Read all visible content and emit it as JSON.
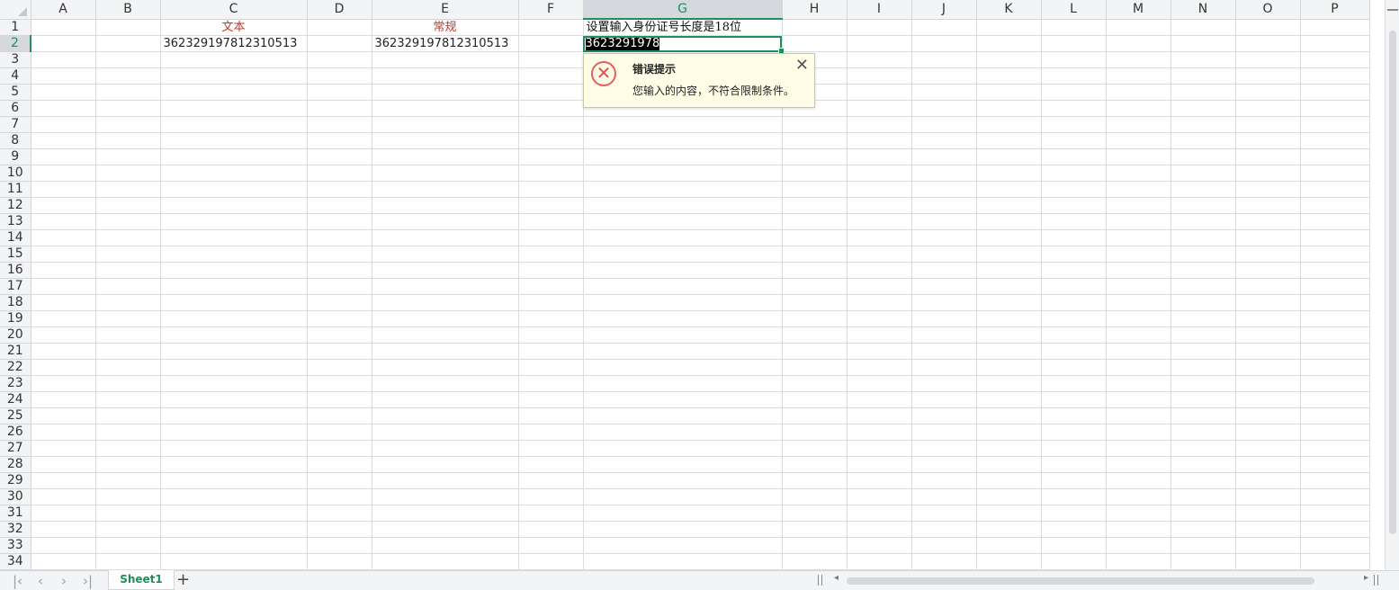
{
  "columns": [
    "A",
    "B",
    "C",
    "D",
    "E",
    "F",
    "G",
    "H",
    "I",
    "J",
    "K",
    "L",
    "M",
    "N",
    "O",
    "P"
  ],
  "rows": [
    "1",
    "2",
    "3",
    "4",
    "5",
    "6",
    "7",
    "8",
    "9",
    "10",
    "11",
    "12",
    "13",
    "14",
    "15",
    "16",
    "17",
    "18",
    "19",
    "20",
    "21",
    "22",
    "23",
    "24",
    "25",
    "26",
    "27",
    "28",
    "29",
    "30",
    "31",
    "32",
    "33",
    "34"
  ],
  "cells": {
    "C1": "文本",
    "E1": "常规",
    "G1": "设置输入身份证号长度是18位",
    "C2": "362329197812310513",
    "E2": "362329197812310513",
    "G2": "3623291978"
  },
  "active_cell": "G2",
  "error_tip": {
    "title": "错误提示",
    "message": "您输入的内容，不符合限制条件。",
    "icon": "error-x-icon",
    "close_icon": "close-icon"
  },
  "sheet_tabs": [
    "Sheet1"
  ],
  "colors": {
    "accent": "#1e8e5a",
    "header_text_red": "#c0392b",
    "tip_background": "#fffde6"
  }
}
